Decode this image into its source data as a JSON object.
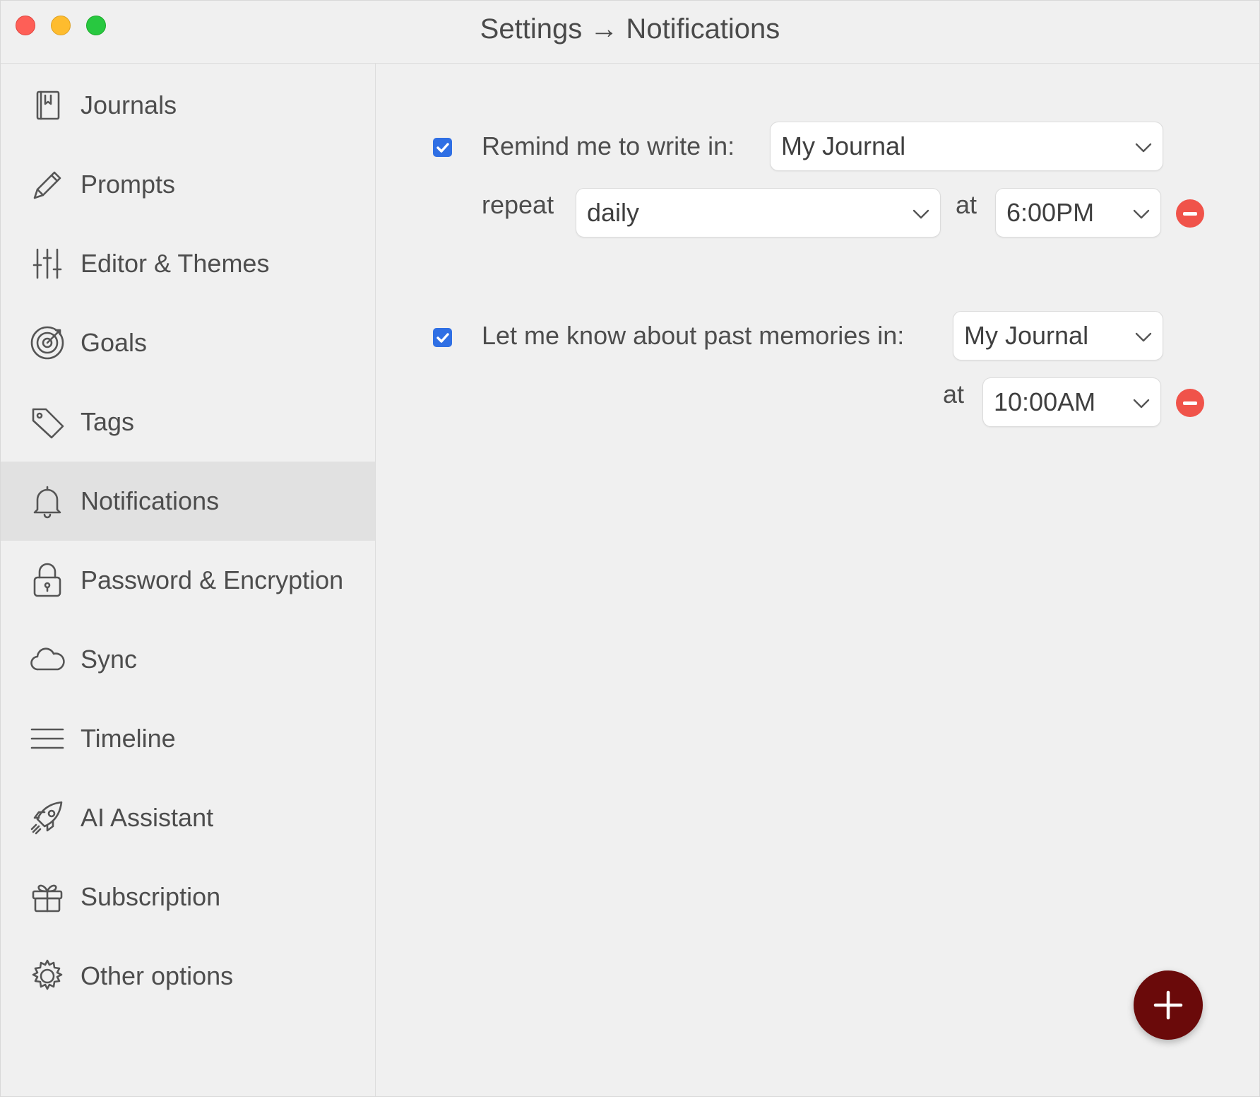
{
  "window": {
    "title": "Settings → Notifications"
  },
  "sidebar": {
    "items": [
      {
        "label": "Journals",
        "icon": "journal-icon"
      },
      {
        "label": "Prompts",
        "icon": "pencil-icon"
      },
      {
        "label": "Editor & Themes",
        "icon": "sliders-icon"
      },
      {
        "label": "Goals",
        "icon": "target-icon"
      },
      {
        "label": "Tags",
        "icon": "tag-icon"
      },
      {
        "label": "Notifications",
        "icon": "bell-icon",
        "active": true
      },
      {
        "label": "Password & Encryption",
        "icon": "lock-icon"
      },
      {
        "label": "Sync",
        "icon": "cloud-icon"
      },
      {
        "label": "Timeline",
        "icon": "lines-icon"
      },
      {
        "label": "AI Assistant",
        "icon": "rocket-icon"
      },
      {
        "label": "Subscription",
        "icon": "gift-icon"
      },
      {
        "label": "Other options",
        "icon": "gear-icon"
      }
    ]
  },
  "reminder": {
    "checked": true,
    "label": "Remind me to write in:",
    "journal": "My Journal",
    "repeat_label": "repeat",
    "repeat_value": "daily",
    "at_label": "at",
    "time": "6:00PM"
  },
  "memories": {
    "checked": true,
    "label": "Let me know about past memories in:",
    "journal": "My Journal",
    "at_label": "at",
    "time": "10:00AM"
  },
  "colors": {
    "checkbox": "#2f6fe4",
    "remove": "#f0534a",
    "fab": "#6a0a0a",
    "sidebar_active": "#e1e1e1"
  }
}
